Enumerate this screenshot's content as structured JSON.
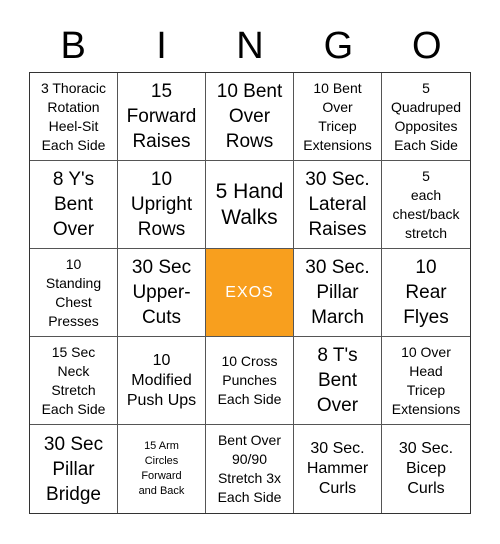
{
  "header": {
    "letters": [
      "B",
      "I",
      "N",
      "G",
      "O"
    ]
  },
  "free_space": {
    "label": "EXOS",
    "color": "#f89f1e"
  },
  "cells": [
    "3 Thoracic\nRotation\nHeel-Sit\nEach Side",
    "15\nForward\nRaises",
    "10 Bent\nOver\nRows",
    "10 Bent\nOver\nTricep\nExtensions",
    "5\nQuadruped\nOpposites\nEach Side",
    "8 Y's\nBent\nOver",
    "10\nUpright\nRows",
    "5 Hand\nWalks",
    "30 Sec.\nLateral\nRaises",
    "5\neach\nchest/back\nstretch",
    "10\nStanding\nChest\nPresses",
    "30 Sec\nUpper-\nCuts",
    "EXOS",
    "30 Sec.\nPillar\nMarch",
    "10\nRear\nFlyes",
    "15 Sec\nNeck\nStretch\nEach Side",
    "10\nModified\nPush Ups",
    "10 Cross\nPunches\nEach Side",
    "8 T's\nBent\nOver",
    "10 Over\nHead\nTricep\nExtensions",
    "30 Sec\nPillar\nBridge",
    "15 Arm\nCircles\nForward\nand Back",
    "Bent Over\n90/90\nStretch 3x\nEach Side",
    "30 Sec.\nHammer\nCurls",
    "30 Sec.\nBicep\nCurls"
  ]
}
